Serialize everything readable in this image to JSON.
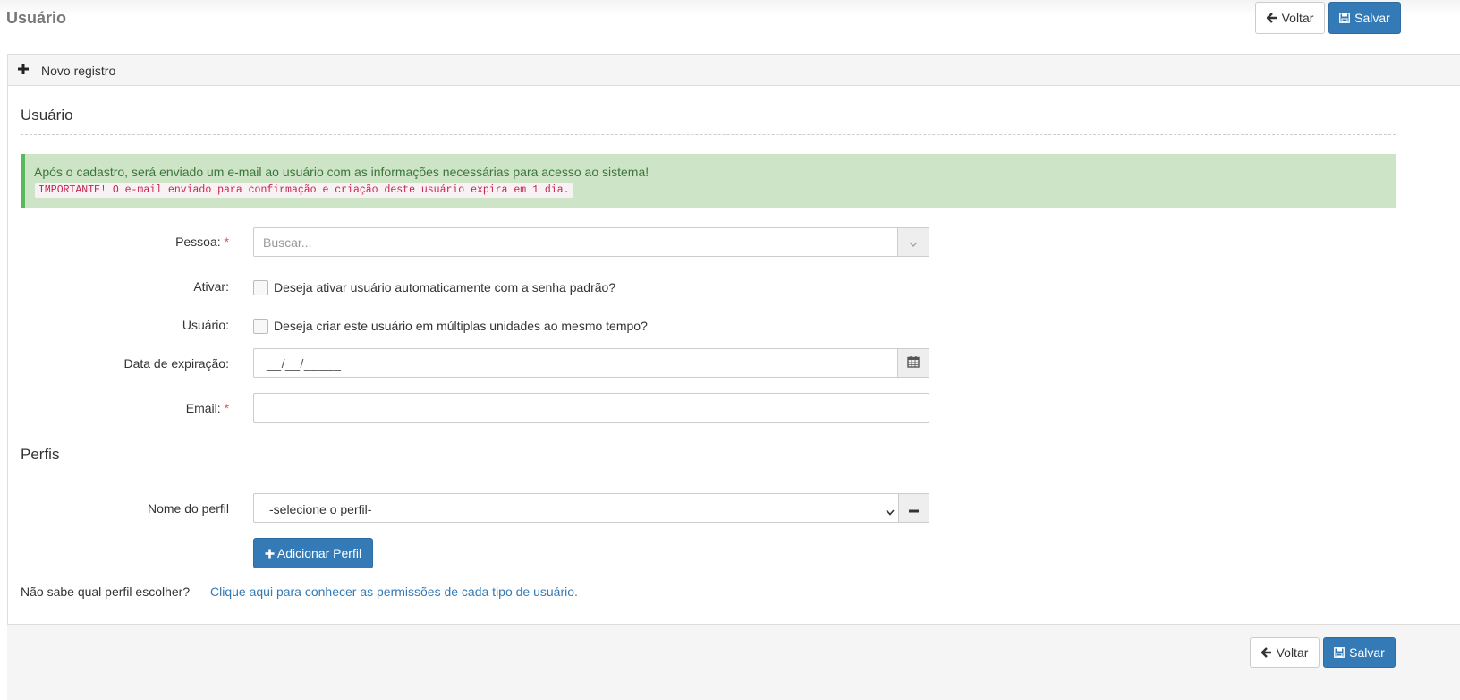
{
  "header": {
    "title": "Usuário",
    "back_label": "Voltar",
    "save_label": "Salvar"
  },
  "panel": {
    "heading": "Novo registro"
  },
  "section_user": {
    "title": "Usuário",
    "alert_message": "Após o cadastro, será enviado um e-mail ao usuário com as informações necessárias para acesso ao sistema!",
    "alert_important": "IMPORTANTE! O e-mail enviado para confirmação e criação deste usuário expira em 1 dia."
  },
  "form": {
    "pessoa": {
      "label": "Pessoa:",
      "required": "*",
      "placeholder": "Buscar..."
    },
    "ativar": {
      "label": "Ativar:",
      "checkbox_label": "Deseja ativar usuário automaticamente com a senha padrão?",
      "checked": false
    },
    "usuario": {
      "label": "Usuário:",
      "checkbox_label": "Deseja criar este usuário em múltiplas unidades ao mesmo tempo?",
      "checked": false
    },
    "data_expiracao": {
      "label": "Data de expiração:",
      "mask": "__/__/_____"
    },
    "email": {
      "label": "Email:",
      "required": "*",
      "value": ""
    }
  },
  "section_perfis": {
    "title": "Perfis",
    "nome_label": "Nome do perfil",
    "select_value": "-selecione o perfil-",
    "add_label": "Adicionar Perfil",
    "help_text": "Não sabe qual perfil escolher?",
    "help_link": "Clique aqui para conhecer as permissões de cada tipo de usuário."
  },
  "footer": {
    "back_label": "Voltar",
    "save_label": "Salvar"
  },
  "colors": {
    "primary": "#337ab7",
    "alert_bg": "#cde4c6",
    "alert_border": "#5cb85c",
    "required": "#d9534f"
  },
  "icons": {
    "back": "arrow-left-icon",
    "save": "floppy-disk-icon",
    "plus": "plus-icon",
    "chevron": "chevron-down-icon",
    "calendar": "calendar-icon",
    "minus": "minus-icon"
  }
}
